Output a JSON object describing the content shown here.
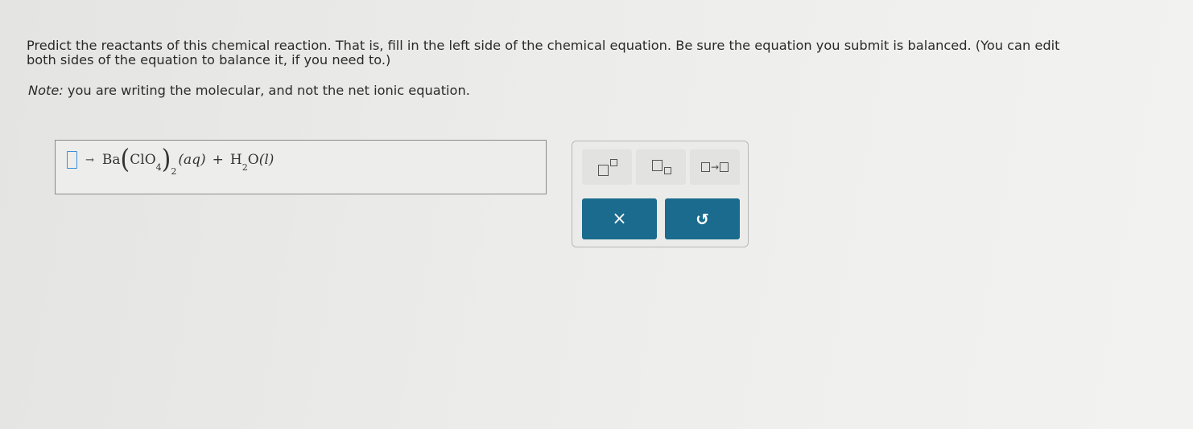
{
  "prompt": {
    "line1": "Predict the reactants of this chemical reaction. That is, fill in the left side of the chemical equation. Be sure the equation you submit is balanced. (You can edit",
    "line2": "both sides of the equation to balance it, if you need to.)"
  },
  "note": {
    "label": "Note:",
    "text": " you are writing the molecular, and not the net ionic equation."
  },
  "equation": {
    "arrow": "→",
    "ba": "Ba",
    "clo": "ClO",
    "sub4": "4",
    "sub2": "2",
    "aq": "(aq)",
    "plus": "+",
    "h": "H",
    "hsub": "2",
    "o": "O",
    "l": "(l)"
  },
  "tools": {
    "reaction_arrow": "→"
  },
  "actions": {
    "clear_symbol": "×",
    "undo_symbol": "↺"
  }
}
